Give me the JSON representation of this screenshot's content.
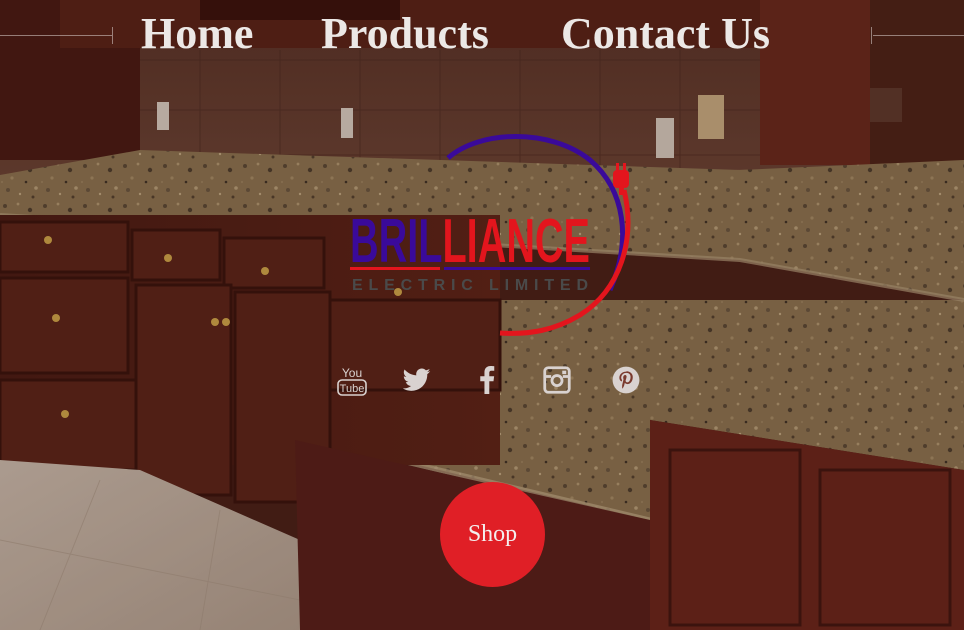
{
  "nav": {
    "home": "Home",
    "products": "Products",
    "contact": "Contact Us"
  },
  "logo": {
    "brand_part1": "BRIL",
    "brand_part2": "LIANCE",
    "tagline": "ELECTRIC LIMITED",
    "colors": {
      "purple": "#3a0a9a",
      "red": "#e3151d",
      "gray": "#4a4a4a"
    }
  },
  "social": [
    {
      "name": "youtube",
      "glyph_top": "You",
      "glyph_bottom": "Tube"
    },
    {
      "name": "twitter"
    },
    {
      "name": "facebook"
    },
    {
      "name": "instagram"
    },
    {
      "name": "pinterest"
    }
  ],
  "shop": {
    "label": "Shop",
    "color": "#e01f26"
  },
  "theme": {
    "nav_text_color": "#ece8e6",
    "icon_color": "#d9d2d0"
  }
}
